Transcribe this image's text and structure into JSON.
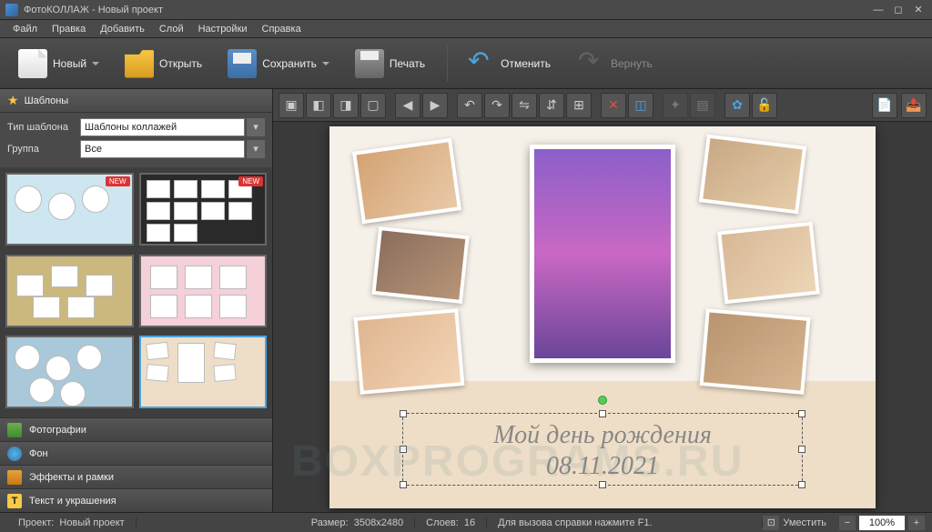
{
  "app": {
    "title": "ФотоКОЛЛАЖ - Новый проект"
  },
  "menu": [
    "Файл",
    "Правка",
    "Добавить",
    "Слой",
    "Настройки",
    "Справка"
  ],
  "toolbar": {
    "new": "Новый",
    "open": "Открыть",
    "save": "Сохранить",
    "print": "Печать",
    "undo": "Отменить",
    "redo": "Вернуть"
  },
  "left": {
    "tab_templates": "Шаблоны",
    "type_label": "Тип шаблона",
    "type_value": "Шаблоны коллажей",
    "group_label": "Группа",
    "group_value": "Все",
    "new_badge": "NEW",
    "acc_photos": "Фотографии",
    "acc_bg": "Фон",
    "acc_effects": "Эффекты и рамки",
    "acc_text": "Текст и украшения"
  },
  "canvas_text": {
    "line1": "Мой день рождения",
    "line2": "08.11.2021"
  },
  "status": {
    "project_label": "Проект:",
    "project_value": "Новый проект",
    "size_label": "Размер:",
    "size_value": "3508x2480",
    "layers_label": "Слоев:",
    "layers_value": "16",
    "help": "Для вызова справки нажмите F1.",
    "fit": "Уместить",
    "zoom": "100%"
  },
  "watermark": "BOXPROGRAMS.RU"
}
